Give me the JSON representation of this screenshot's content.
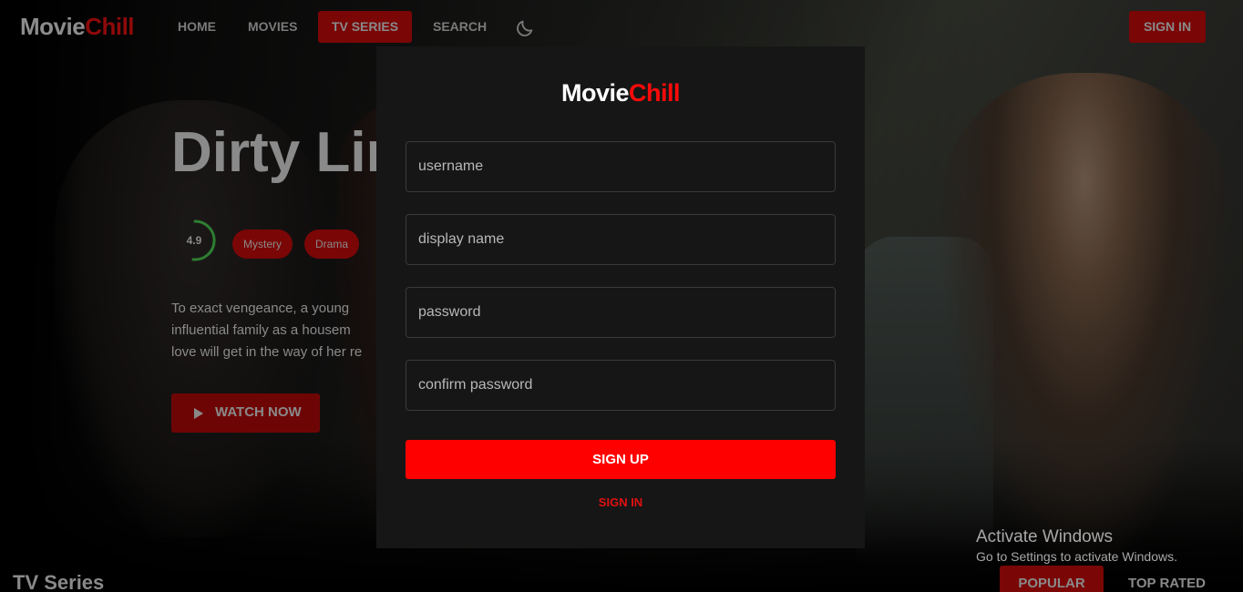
{
  "header": {
    "logo_part1": "Movie",
    "logo_part2": "Chill",
    "nav": {
      "home": "HOME",
      "movies": "MOVIES",
      "tv_series": "TV SERIES",
      "search": "SEARCH"
    },
    "theme_icon": "moon-icon",
    "sign_in": "SIGN IN"
  },
  "hero": {
    "title": "Dirty Lin",
    "rating": "4.9",
    "genres": [
      "Mystery",
      "Drama"
    ],
    "overview_lines": [
      "To exact vengeance, a young",
      "influential family as a housem",
      "love will get in the way of her re"
    ],
    "watch_now": "WATCH NOW"
  },
  "modal": {
    "logo_part1": "Movie",
    "logo_part2": "Chill",
    "fields": {
      "username_placeholder": "username",
      "display_name_placeholder": "display name",
      "password_placeholder": "password",
      "confirm_password_placeholder": "confirm password"
    },
    "sign_up": "SIGN UP",
    "sign_in_link": "SIGN IN"
  },
  "section": {
    "title": "TV Series",
    "tabs": [
      "POPULAR",
      "TOP RATED"
    ]
  },
  "watermark": {
    "title": "Activate Windows",
    "subtitle": "Go to Settings to activate Windows."
  },
  "colors": {
    "accent": "#ff0000",
    "accent_dim": "#7a0606",
    "modal_bg": "#161616",
    "rating_ring": "#2e7d32"
  }
}
